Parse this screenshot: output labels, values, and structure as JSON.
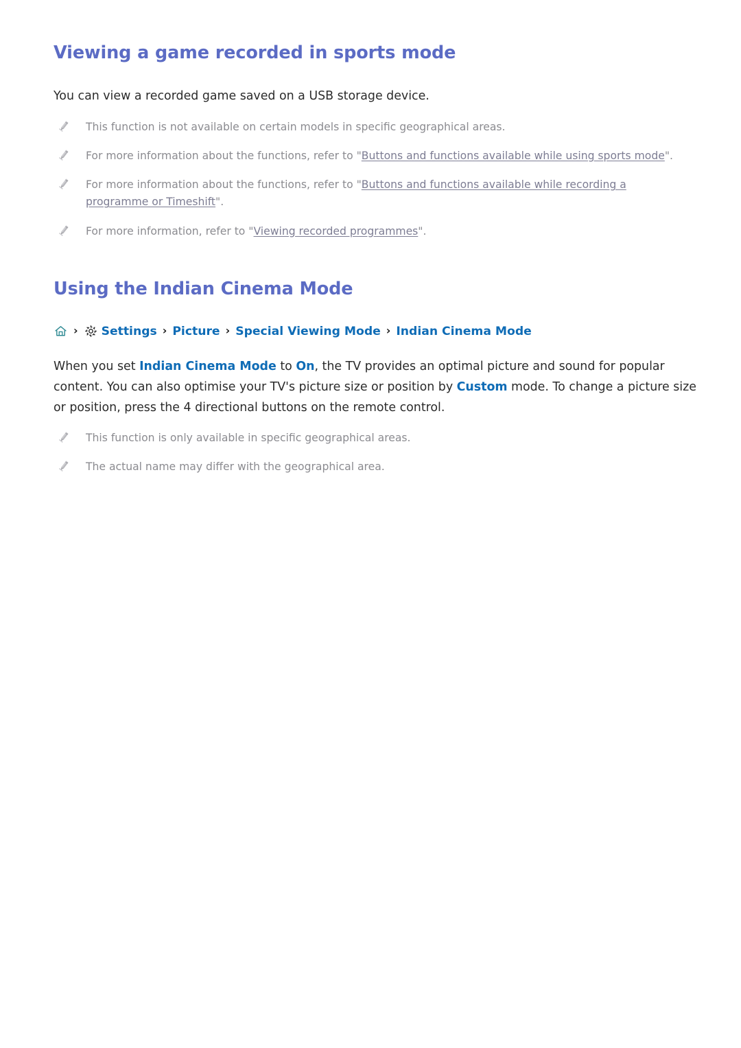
{
  "document": {
    "sections": [
      {
        "heading": "Viewing a game recorded in sports mode",
        "intro": "You can view a recorded game saved on a USB storage device.",
        "notes": [
          {
            "pre": "This function is not available on certain models in specific geographical areas.",
            "link": "",
            "post": ""
          },
          {
            "pre": "For more information about the functions, refer to \"",
            "link": "Buttons and functions available while using sports mode",
            "post": "\"."
          },
          {
            "pre": "For more information about the functions, refer to \"",
            "link": "Buttons and functions available while recording a programme or Timeshift",
            "post": "\"."
          },
          {
            "pre": "For more information, refer to \"",
            "link": "Viewing recorded programmes",
            "post": "\"."
          }
        ]
      },
      {
        "heading": "Using the Indian Cinema Mode",
        "breadcrumb": {
          "home_icon": "home-icon",
          "gear_icon": "gear-icon",
          "separator": "›",
          "items": [
            "Settings",
            "Picture",
            "Special Viewing Mode",
            "Indian Cinema Mode"
          ]
        },
        "paragraph": {
          "p1": "When you set ",
          "em1": "Indian Cinema Mode",
          "p2": " to ",
          "em2": "On",
          "p3": ", the TV provides an optimal picture and sound for popular content. You can also optimise your TV's picture size or position by ",
          "em3": "Custom",
          "p4": " mode. To change a picture size or position, press the 4 directional buttons on the remote control."
        },
        "notes": [
          {
            "pre": "This function is only available in specific geographical areas.",
            "link": "",
            "post": ""
          },
          {
            "pre": "The actual name may differ with the geographical area.",
            "link": "",
            "post": ""
          }
        ]
      }
    ]
  },
  "colors": {
    "heading": "#5b6bc4",
    "breadcrumb_link": "#0f6cb6",
    "note_text": "#8b8b90",
    "doc_link": "#7d7d93",
    "body_text": "#2b2b2b",
    "home_icon": "#2f8a93",
    "background": "#ffffff"
  }
}
